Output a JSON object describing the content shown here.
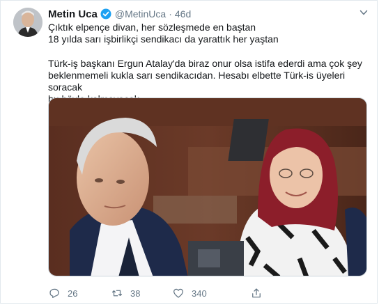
{
  "tweet": {
    "author_name": "Metin Uca",
    "handle": "@MetinUca",
    "separator": "·",
    "time": "46d",
    "lines": [
      "Çıktık elpençe divan, her sözleşmede en baştan",
      "18 yılda sarı işbirlikçi sendikacı da yarattık her yaştan",
      "Türk-iş başkanı Ergun Atalay'da biraz onur olsa istifa ederdi ama çok şey",
      "beklenmemeli  kukla sarı sendikacıdan. Hesabı elbette Türk-is üyeleri soracak",
      "bu böyle kalmayacak"
    ]
  },
  "actions": {
    "reply_count": "26",
    "retweet_count": "38",
    "like_count": "340"
  },
  "icons": {
    "verified": "verified-badge-icon",
    "caret": "chevron-down-icon",
    "reply": "reply-icon",
    "retweet": "retweet-icon",
    "like": "heart-icon",
    "share": "share-icon"
  },
  "colors": {
    "verified": "#1da1f2",
    "secondary_text": "#657786",
    "primary_text": "#14171a"
  }
}
